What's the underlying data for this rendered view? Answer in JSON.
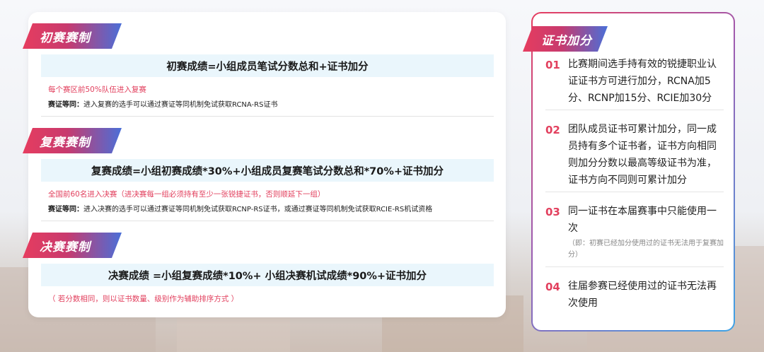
{
  "sections": [
    {
      "title": "初赛赛制",
      "formula": "初赛成绩=小组成员笔试分数总和+证书加分",
      "red_note": "每个赛区前50%队伍进入复赛",
      "equiv_label": "赛证等同：",
      "equiv_text": "进入复赛的选手可以通过赛证等同机制免试获取RCNA-RS证书"
    },
    {
      "title": "复赛赛制",
      "formula": "复赛成绩=小组初赛成绩*30%+小组成员复赛笔试分数总和*70%+证书加分",
      "red_note": "全国前60名进入决赛（进决赛每一组必须持有至少一张锐捷证书，否则顺延下一组）",
      "equiv_label": "赛证等同：",
      "equiv_text": "进入决赛的选手可以通过赛证等同机制免试获取RCNP-RS证书，或通过赛证等同机制免试获取RCIE-RS机试资格"
    },
    {
      "title": "决赛赛制",
      "formula": "决赛成绩 =小组复赛成绩*10%+ 小组决赛机试成绩*90%+证书加分",
      "red_note": "（ 若分数相同，则以证书数量、级别作为辅助排序方式 ）"
    }
  ],
  "bonus": {
    "title": "证书加分",
    "items": [
      {
        "num": "01",
        "text": "比赛期间选手持有效的锐捷职业认证证书方可进行加分，RCNA加5分、RCNP加15分、RCIE加30分"
      },
      {
        "num": "02",
        "text": "团队成员证书可累计加分，同一成员持有多个证书者，证书方向相同则加分分数以最高等级证书为准，证书方向不同则可累计加分"
      },
      {
        "num": "03",
        "text": "同一证书在本届赛事中只能使用一次",
        "sub": "（即：初赛已经加分使用过的证书无法用于复赛加分）"
      },
      {
        "num": "04",
        "text": "往届参赛已经使用过的证书无法再次使用"
      }
    ]
  }
}
